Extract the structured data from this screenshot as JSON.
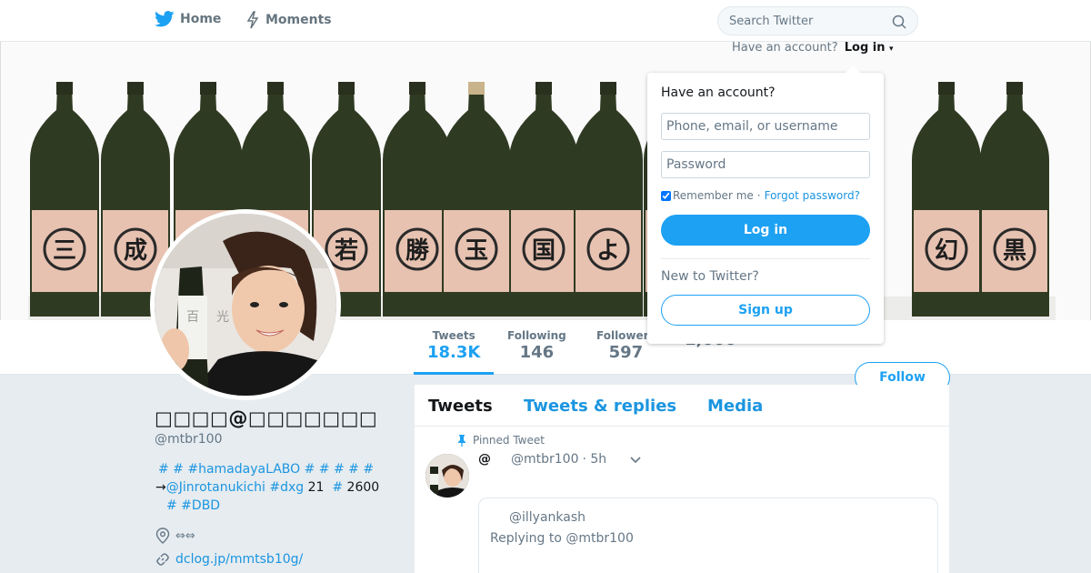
{
  "nav": {
    "home_label": "Home",
    "moments_label": "Moments",
    "search_placeholder": "Search Twitter"
  },
  "account_prompt": {
    "text": "Have an account?",
    "login_label": "Log in"
  },
  "login_dropdown": {
    "heading": "Have an account?",
    "username_placeholder": "Phone, email, or username",
    "password_placeholder": "Password",
    "remember_label": "Remember me",
    "separator": "·",
    "forgot_label": "Forgot password?",
    "login_button": "Log in",
    "new_label": "New to Twitter?",
    "signup_button": "Sign up"
  },
  "banner": {
    "bottle_labels": [
      "三",
      "成",
      "",
      "",
      "若",
      "勝",
      "玉",
      "国",
      "よ",
      "",
      "",
      "",
      "幻",
      "黒"
    ]
  },
  "stats": [
    {
      "label": "Tweets",
      "value": "18.3K",
      "active": true
    },
    {
      "label": "Following",
      "value": "146"
    },
    {
      "label": "Followers",
      "value": "597"
    },
    {
      "label": "",
      "value": "1,000"
    }
  ],
  "follow_button": "Follow",
  "profile": {
    "name": "□□□□@□□□□□□□",
    "handle": "@mtbr100",
    "bio_line1": "# # #hamadayaLABO # # # # #",
    "bio_line2_arrow": "→",
    "bio_line2_mention": "@Jinrotanukichi",
    "bio_line2_tag": "#dxg",
    "bio_line2_num1": "21",
    "bio_line2_hash": "#",
    "bio_line2_num2": "2600",
    "bio_line3": "# #DBD",
    "location": "⇔⇔",
    "url": "dclog.jp/mmtsb10g/"
  },
  "timeline": {
    "tabs": [
      "Tweets",
      "Tweets & replies",
      "Media"
    ],
    "pinned_label": "Pinned Tweet",
    "tweet_at": "@",
    "tweet_handle": "@mtbr100",
    "tweet_time": "· 5h",
    "quote_handle": "@illyankash",
    "quote_reply": "Replying to @mtbr100"
  },
  "colors": {
    "accent": "#1da1f2",
    "link": "#1b95e0",
    "bottle_green": "#2f3a22",
    "label_pink": "#e7c2b1"
  }
}
